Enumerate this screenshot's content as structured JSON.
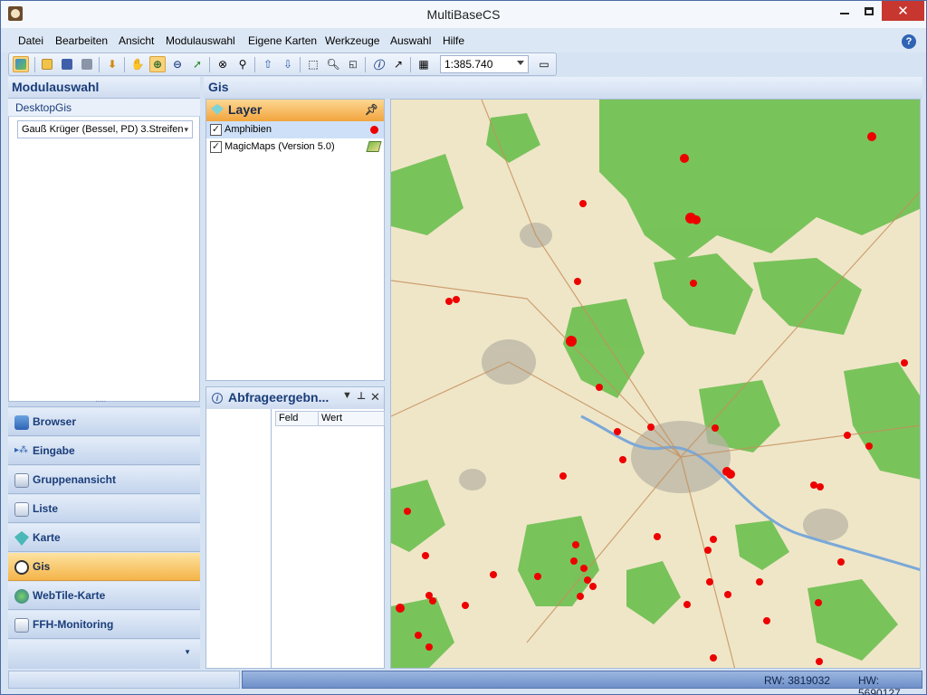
{
  "window": {
    "title": "MultiBaseCS"
  },
  "menu": [
    "Datei",
    "Bearbeiten",
    "Ansicht",
    "Modulauswahl",
    "Eigene Karten",
    "Werkzeuge",
    "Auswahl",
    "Hilfe"
  ],
  "toolbar": {
    "scale_value": "1:385.740"
  },
  "left_panel": {
    "title": "Modulauswahl",
    "tab": "DesktopGis",
    "crs_selected": "Gauß Krüger (Bessel, PD) 3.Streifen",
    "nav": [
      {
        "label": "Browser",
        "icon": "browser-icon"
      },
      {
        "label": "Eingabe",
        "icon": "eingabe-icon"
      },
      {
        "label": "Gruppenansicht",
        "icon": "gruppenansicht-icon"
      },
      {
        "label": "Liste",
        "icon": "liste-icon"
      },
      {
        "label": "Karte",
        "icon": "karte-icon"
      },
      {
        "label": "Gis",
        "icon": "gis-globe-icon",
        "selected": true
      },
      {
        "label": "WebTile-Karte",
        "icon": "webtile-globe-icon"
      },
      {
        "label": "FFH-Monitoring",
        "icon": "ffh-monitoring-icon"
      }
    ]
  },
  "gis": {
    "title": "Gis",
    "layer_panel": {
      "title": "Layer",
      "layers": [
        {
          "name": "Amphibien",
          "checked": true,
          "symbol": "red-dot"
        },
        {
          "name": "MagicMaps (Version 5.0)",
          "checked": true,
          "symbol": "map-icon"
        }
      ]
    },
    "query_panel": {
      "title": "Abfrageergebn...",
      "columns": [
        "Feld",
        "Wert"
      ]
    }
  },
  "status": {
    "rw": "RW: 3819032",
    "hw": "HW: 5690127"
  },
  "colors": {
    "accent_orange": "#f5b44a",
    "point_red": "#ee0000",
    "forest_green": "#6cbf4f"
  }
}
